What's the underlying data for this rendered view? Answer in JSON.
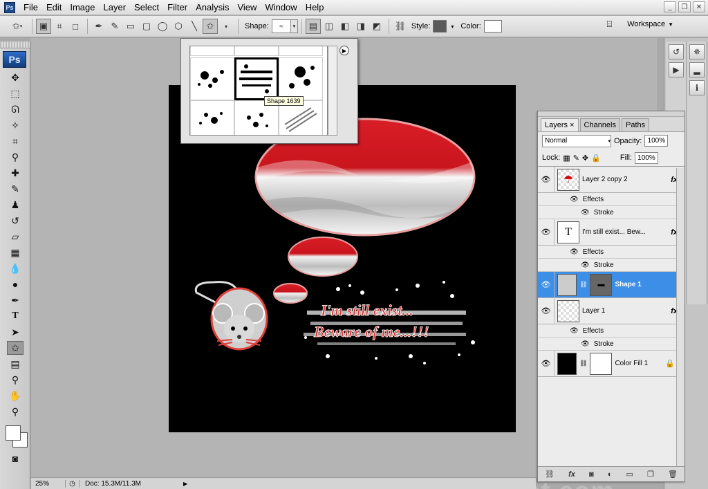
{
  "menu": [
    "File",
    "Edit",
    "Image",
    "Layer",
    "Select",
    "Filter",
    "Analysis",
    "View",
    "Window",
    "Help"
  ],
  "app_icon": "Ps",
  "options": {
    "shape_label": "Shape:",
    "style_label": "Style:",
    "color_label": "Color:",
    "workspace": "Workspace",
    "style_color": "#5a5a5a",
    "fill_color": "#ffffff"
  },
  "shape_picker": {
    "tooltip": "Shape 1639"
  },
  "canvas": {
    "background": "#000000",
    "text_line1": "I'm still exist...",
    "text_line2": "Beware of me...!!!"
  },
  "watermark": "http://belajardesigntshirt.blogspot.com",
  "status": {
    "zoom": "25%",
    "doc": "Doc: 15.3M/11.3M"
  },
  "layers": {
    "tabs": [
      "Layers",
      "Channels",
      "Paths"
    ],
    "blend_mode": "Normal",
    "opacity_label": "Opacity:",
    "opacity": "100%",
    "lock_label": "Lock:",
    "fill_label": "Fill:",
    "fill": "100%",
    "items": [
      {
        "name": "Layer 2 copy 2",
        "effects": "Effects",
        "stroke": "Stroke"
      },
      {
        "name": "I'm still exist... Bew...",
        "effects": "Effects",
        "stroke": "Stroke"
      },
      {
        "name": "Shape 1"
      },
      {
        "name": "Layer 1",
        "effects": "Effects",
        "stroke": "Stroke"
      },
      {
        "name": "Color Fill 1"
      }
    ]
  }
}
